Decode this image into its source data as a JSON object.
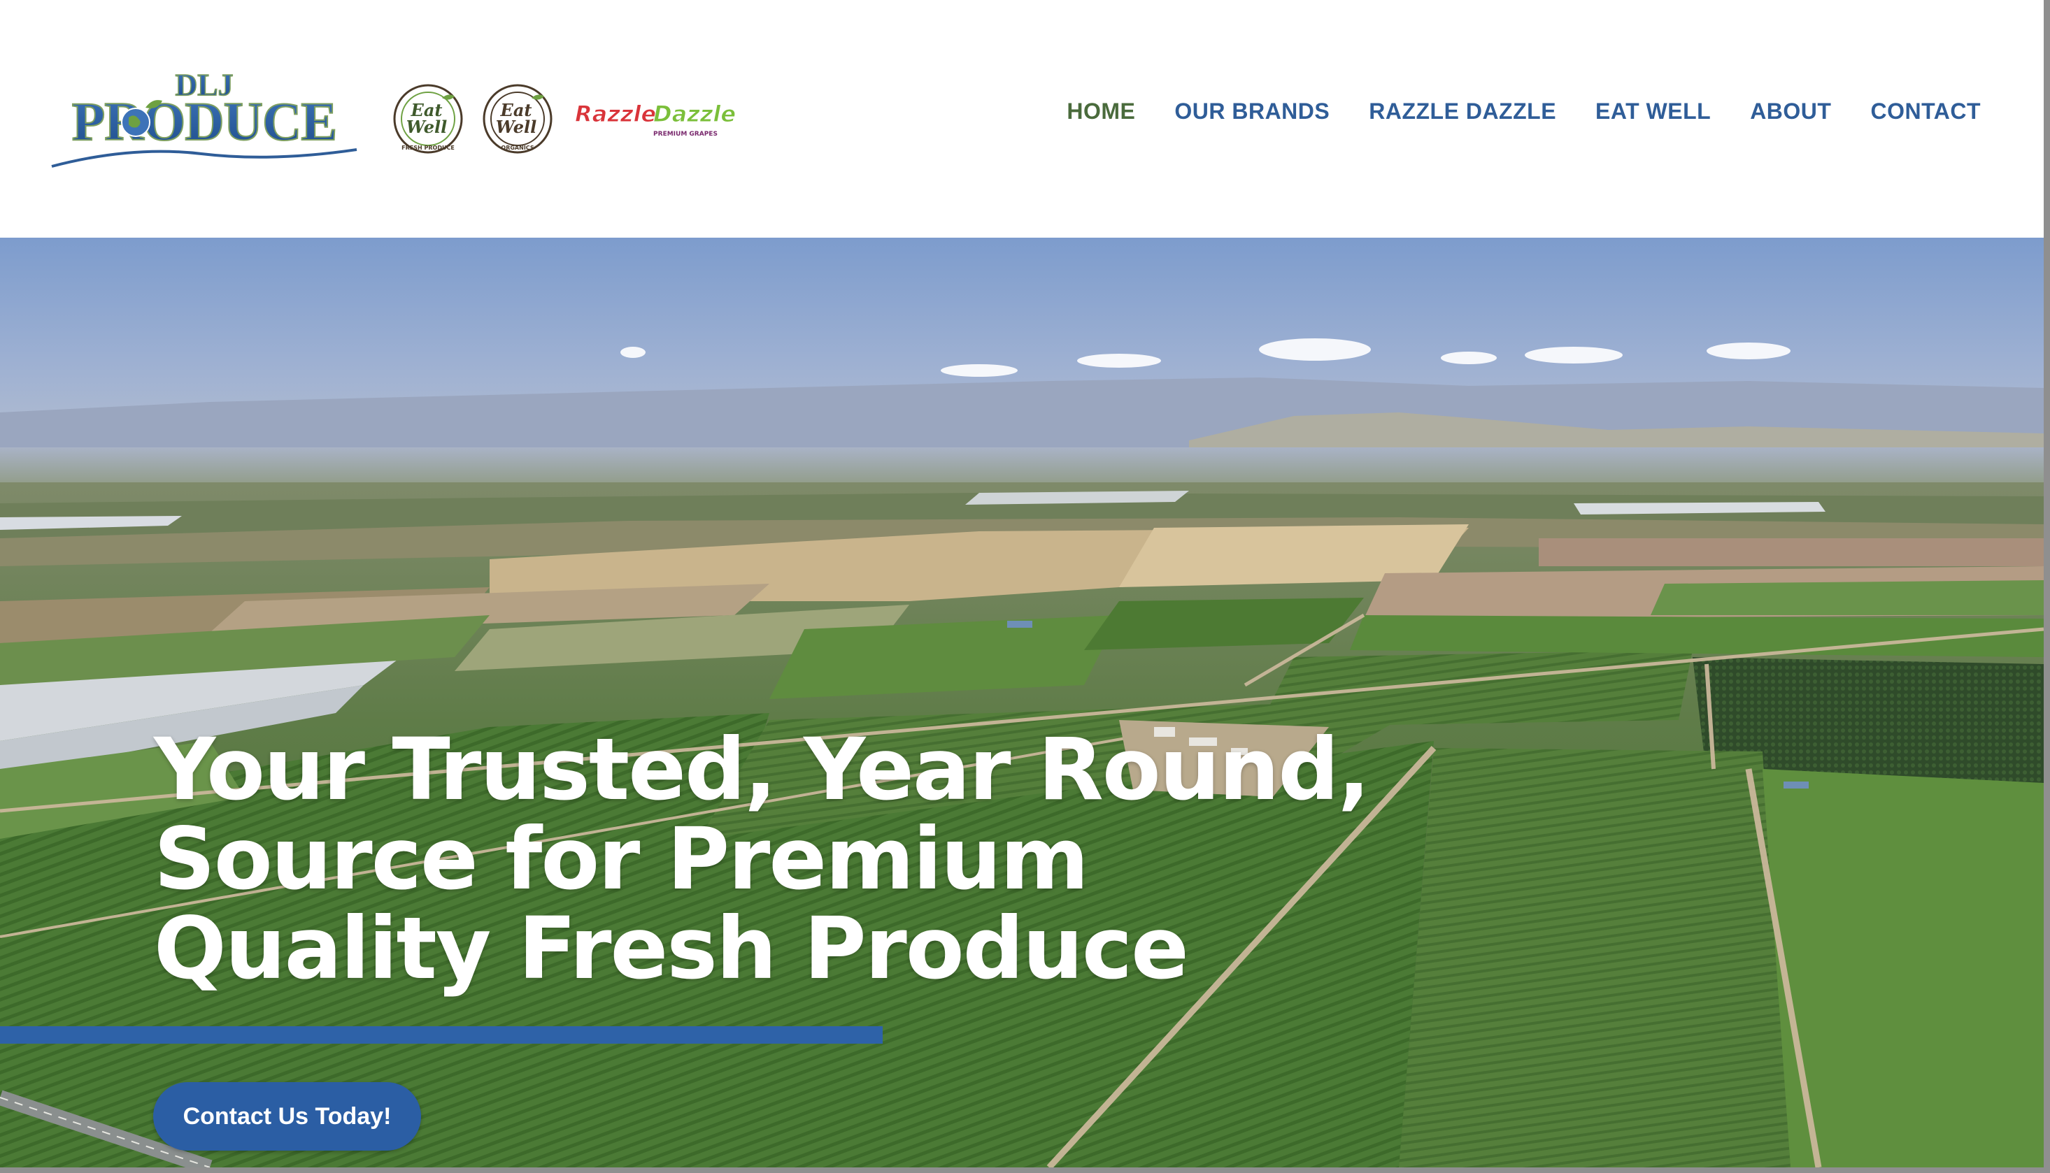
{
  "header": {
    "logo_text_top": "DLJ",
    "logo_text_main": "PRODUCE",
    "brand_logos": [
      {
        "name": "eat-well-fresh-produce",
        "line1": "Eat",
        "line2": "Well",
        "ring": "FRESH PRODUCE"
      },
      {
        "name": "eat-well-organics",
        "line1": "Eat",
        "line2": "Well",
        "ring": "ORGANICS"
      },
      {
        "name": "razzle-dazzle",
        "word1": "Razzle",
        "word2": "Dazzle",
        "tagline": "PREMIUM GRAPES"
      }
    ]
  },
  "nav": {
    "items": [
      "HOME",
      "OUR BRANDS",
      "RAZZLE DAZZLE",
      "EAT WELL",
      "ABOUT",
      "CONTACT"
    ],
    "active": "HOME"
  },
  "hero": {
    "title_lines": [
      "Your Trusted, Year Round,",
      "Source for Premium",
      "Quality Fresh Produce"
    ],
    "cta_label": "Contact Us Today!"
  },
  "colors": {
    "nav_blue": "#2f5d98",
    "nav_active_green": "#4a6b3c",
    "accent_blue": "#2e62a8",
    "cta_blue": "#2b5ea4"
  }
}
